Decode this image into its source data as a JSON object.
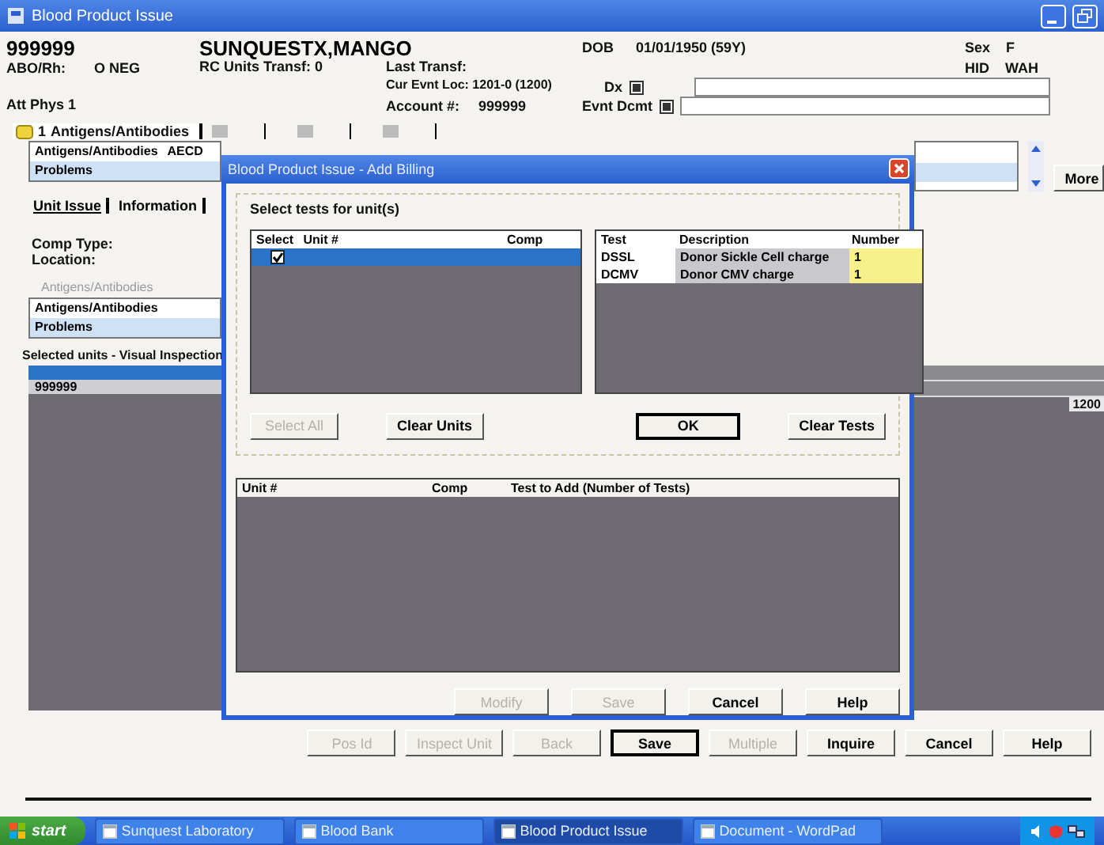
{
  "window": {
    "title": "Blood Product Issue"
  },
  "patient": {
    "id": "999999",
    "name": "SUNQUESTX,MANGO",
    "abo_label": "ABO/Rh:",
    "abo": "O NEG",
    "rc_units": "RC Units Transf: 0",
    "last_transf": "Last Transf:",
    "cur_loc": "Cur Evnt Loc: 1201-0 (1200)",
    "account_label": "Account #:",
    "account": "999999",
    "att_phys": "Att Phys 1",
    "dob_label": "DOB",
    "dob": "01/01/1950 (59Y)",
    "dx_label": "Dx",
    "evnt_label": "Evnt Dcmt",
    "sex_label": "Sex",
    "sex": "F",
    "hid_label": "HID",
    "hid": "WAH"
  },
  "tabs": [
    {
      "number": "1",
      "label": "Antigens/Antibodies",
      "selected": true
    }
  ],
  "alerts": [
    {
      "label": "Antigens/Antibodies",
      "value": "AECD",
      "selected": false
    },
    {
      "label": "Problems",
      "selected": true
    }
  ],
  "more_button": "More",
  "subtabs": [
    {
      "label": "Unit Issue",
      "selected": true
    },
    {
      "label": "Information",
      "selected": false
    }
  ],
  "comp_type_label": "Comp Type:",
  "location_label": "Location:",
  "lower_tab": "Antigens/Antibodies",
  "lower_alerts": [
    {
      "label": "Antigens/Antibodies",
      "selected": false
    },
    {
      "label": "Problems",
      "selected": true
    }
  ],
  "selected_units": {
    "title": "Selected units - Visual Inspection",
    "rows": [
      {
        "unit": "999999",
        "selected": true
      }
    ]
  },
  "right_grid": {
    "value": "1200"
  },
  "dialog": {
    "title": "Blood Product Issue - Add Billing",
    "group": "Select tests for unit(s)",
    "unit_columns": [
      "Select",
      "Unit #",
      "Comp"
    ],
    "units": [
      {
        "checked": true,
        "selected": true
      }
    ],
    "test_columns": [
      "Test",
      "Description",
      "Number"
    ],
    "tests": [
      {
        "test": "DSSL",
        "description": "Donor Sickle Cell charge",
        "number": "1"
      },
      {
        "test": "DCMV",
        "description": "Donor CMV charge",
        "number": "1"
      }
    ],
    "group_buttons": [
      {
        "label": "Select All",
        "disabled": true,
        "default": false
      },
      {
        "label": "Clear Units",
        "disabled": false,
        "default": false
      },
      {
        "label": "OK",
        "disabled": false,
        "default": true
      },
      {
        "label": "Clear Tests",
        "disabled": false,
        "default": false
      }
    ],
    "add_columns": [
      "Unit #",
      "Comp",
      "Test to Add (Number of Tests)"
    ],
    "buttons": [
      {
        "label": "Modify",
        "disabled": true,
        "default": false
      },
      {
        "label": "Save",
        "disabled": true,
        "default": false
      },
      {
        "label": "Cancel",
        "disabled": false,
        "default": false
      },
      {
        "label": "Help",
        "disabled": false,
        "default": false
      }
    ]
  },
  "buttons": [
    {
      "label": "Pos Id",
      "disabled": true,
      "default": false
    },
    {
      "label": "Inspect Unit",
      "disabled": true,
      "default": false
    },
    {
      "label": "Back",
      "disabled": true,
      "default": false
    },
    {
      "label": "Save",
      "disabled": false,
      "default": true
    },
    {
      "label": "Multiple",
      "disabled": true,
      "default": false
    },
    {
      "label": "Inquire",
      "disabled": false,
      "default": false
    },
    {
      "label": "Cancel",
      "disabled": false,
      "default": false
    },
    {
      "label": "Help",
      "disabled": false,
      "default": false
    }
  ],
  "taskbar": {
    "start": "start",
    "items": [
      {
        "label": "Sunquest Laboratory",
        "selected": false
      },
      {
        "label": "Blood Bank",
        "selected": false
      },
      {
        "label": "Blood Product Issue",
        "selected": true
      },
      {
        "label": "Document - WordPad",
        "selected": false
      }
    ]
  }
}
